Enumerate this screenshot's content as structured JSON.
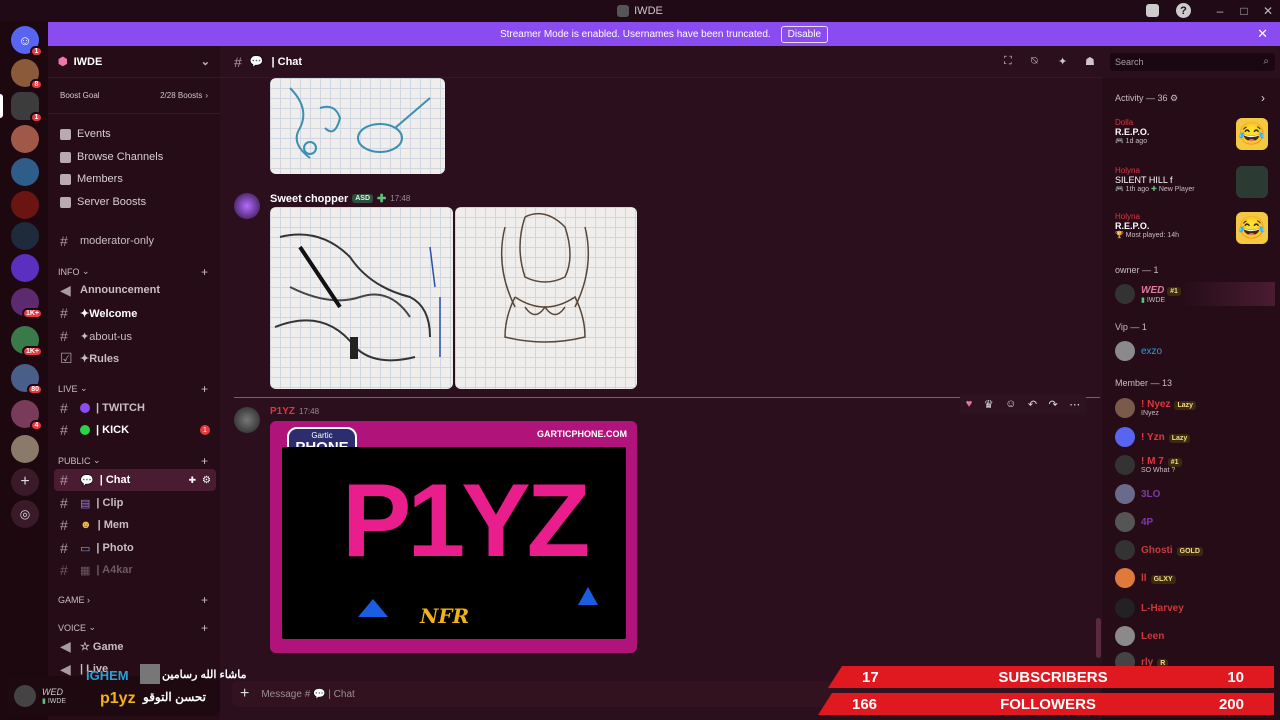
{
  "window": {
    "title": "IWDE"
  },
  "banner": {
    "text": "Streamer Mode is enabled. Usernames have been truncated.",
    "button": "Disable"
  },
  "guild_badges": [
    "1",
    "8",
    "1",
    "1K+",
    "1K+",
    "80",
    "4"
  ],
  "server": {
    "name": "IWDE",
    "boost_goal": "Boost Goal",
    "boost_count": "2/28 Boosts"
  },
  "nav": [
    "Events",
    "Browse Channels",
    "Members",
    "Server Boosts"
  ],
  "channels": {
    "moderator": "moderator-only",
    "info_label": "INFO",
    "info": [
      "Announcement",
      "✦Welcome",
      "✦about-us",
      "✦Rules"
    ],
    "live_label": "LIVE",
    "live": [
      "| TWITCH",
      "| KICK"
    ],
    "kick_badge": "1",
    "public_label": "PUBLIC",
    "public": [
      "| Chat",
      "| Clip",
      "| Mem",
      "| Photo",
      "| A4kar"
    ],
    "game_label": "GAME",
    "voice_label": "VOICE",
    "voice": [
      "☆ Game",
      "| Live"
    ]
  },
  "header": {
    "channel": "| Chat",
    "search_placeholder": "Search"
  },
  "messages": [
    {
      "author": "Sweet chopper",
      "tag": "ASD",
      "time": "17:48"
    },
    {
      "author": "P1YZ",
      "time": "17:48",
      "embed_site": "GARTICPHONE.COM",
      "logo_top": "Gartic",
      "logo_main": "PHONE",
      "art_text": "P1YZ",
      "art_sub": "NFR"
    }
  ],
  "composer": {
    "placeholder": "Message #",
    "channel": "| Chat"
  },
  "activity": {
    "title": "Activity — 36",
    "items": [
      {
        "user": "Dolla",
        "game": "R.E.P.O.",
        "meta": "1d ago"
      },
      {
        "user": "Holyna",
        "game": "SILENT HILL f",
        "meta": "1th ago",
        "extra": "New Player"
      },
      {
        "user": "Holyna",
        "game": "R.E.P.O.",
        "meta": "Most played: 14h"
      }
    ]
  },
  "members": {
    "owner_label": "owner — 1",
    "owner": {
      "name": "WED",
      "tag": "#1",
      "sub": "IWDE"
    },
    "vip_label": "Vip — 1",
    "vip": {
      "name": "exzo"
    },
    "member_label": "Member — 13",
    "list": [
      {
        "name": "! Nyez",
        "tag": "Lazy",
        "sub": "INyez",
        "color": "#e0343e"
      },
      {
        "name": "! Yzn",
        "tag": "Lazy",
        "sub": "",
        "color": "#e0343e"
      },
      {
        "name": "! M 7",
        "tag": "#1",
        "sub": "SO What ?",
        "color": "#e0343e"
      },
      {
        "name": "3LO",
        "tag": "",
        "sub": "",
        "color": "#7d3aa8"
      },
      {
        "name": "4P",
        "tag": "",
        "sub": "",
        "color": "#7d3aa8"
      },
      {
        "name": "Ghosti",
        "tag": "GOLD",
        "sub": "",
        "color": "#c93a3a"
      },
      {
        "name": "ll",
        "tag": "GLXY",
        "sub": "",
        "color": "#c93a3a"
      },
      {
        "name": "L-Harvey",
        "tag": "",
        "sub": "",
        "color": "#c93a3a"
      },
      {
        "name": "Leen",
        "tag": "",
        "sub": "",
        "color": "#c93a3a"
      },
      {
        "name": "rly",
        "tag": "R",
        "sub": "",
        "color": "#c93a3a"
      }
    ]
  },
  "user": {
    "name": "WED",
    "server": "IWDE"
  },
  "overlay": {
    "voice_user": "IGHEM",
    "arabic": "ماشاء الله رسامين",
    "streamer": "p1yz",
    "arabic2": "تحسن التوقو",
    "subs_left": "17",
    "subs_label": "SUBSCRIBERS",
    "subs_right": "10",
    "fol_left": "166",
    "fol_label": "FOLLOWERS",
    "fol_right": "200"
  },
  "colors": {
    "accent": "#8a4cf0",
    "overlay_red": "#e0181f",
    "gartic_pink": "#b0147b"
  }
}
